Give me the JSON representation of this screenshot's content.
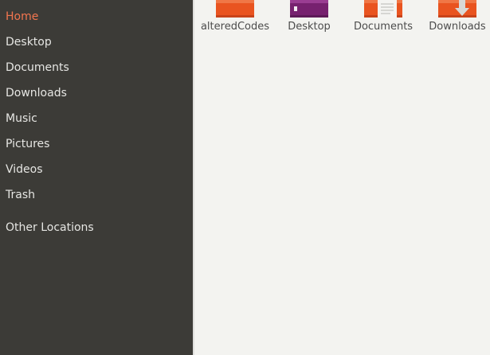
{
  "sidebar": {
    "items": [
      {
        "label": "Home",
        "icon": "home-icon",
        "active": true
      },
      {
        "label": "Desktop",
        "icon": "desktop-icon",
        "active": false
      },
      {
        "label": "Documents",
        "icon": "documents-icon",
        "active": false
      },
      {
        "label": "Downloads",
        "icon": "downloads-icon",
        "active": false
      },
      {
        "label": "Music",
        "icon": "music-icon",
        "active": false
      },
      {
        "label": "Pictures",
        "icon": "pictures-icon",
        "active": false
      },
      {
        "label": "Videos",
        "icon": "videos-icon",
        "active": false
      },
      {
        "label": "Trash",
        "icon": "trash-icon",
        "active": false
      }
    ],
    "other_locations": {
      "label": "Other Locations",
      "icon": "other-locations-icon"
    }
  },
  "files": [
    {
      "name": "alteredCodes",
      "icon": "orange-folder-icon",
      "color": "#e95420"
    },
    {
      "name": "Desktop",
      "icon": "purple-desktop-folder-icon",
      "color": "#77216f"
    },
    {
      "name": "Documents",
      "icon": "documents-folder-icon",
      "color": "#e95420"
    },
    {
      "name": "Downloads",
      "icon": "downloads-folder-icon",
      "color": "#e95420"
    }
  ],
  "colors": {
    "sidebar_bg": "#3c3b37",
    "sidebar_text": "#e6e6e3",
    "active_text": "#f2754f",
    "content_bg": "#f3f3f0",
    "folder_orange": "#e95420",
    "folder_purple": "#77216f"
  }
}
